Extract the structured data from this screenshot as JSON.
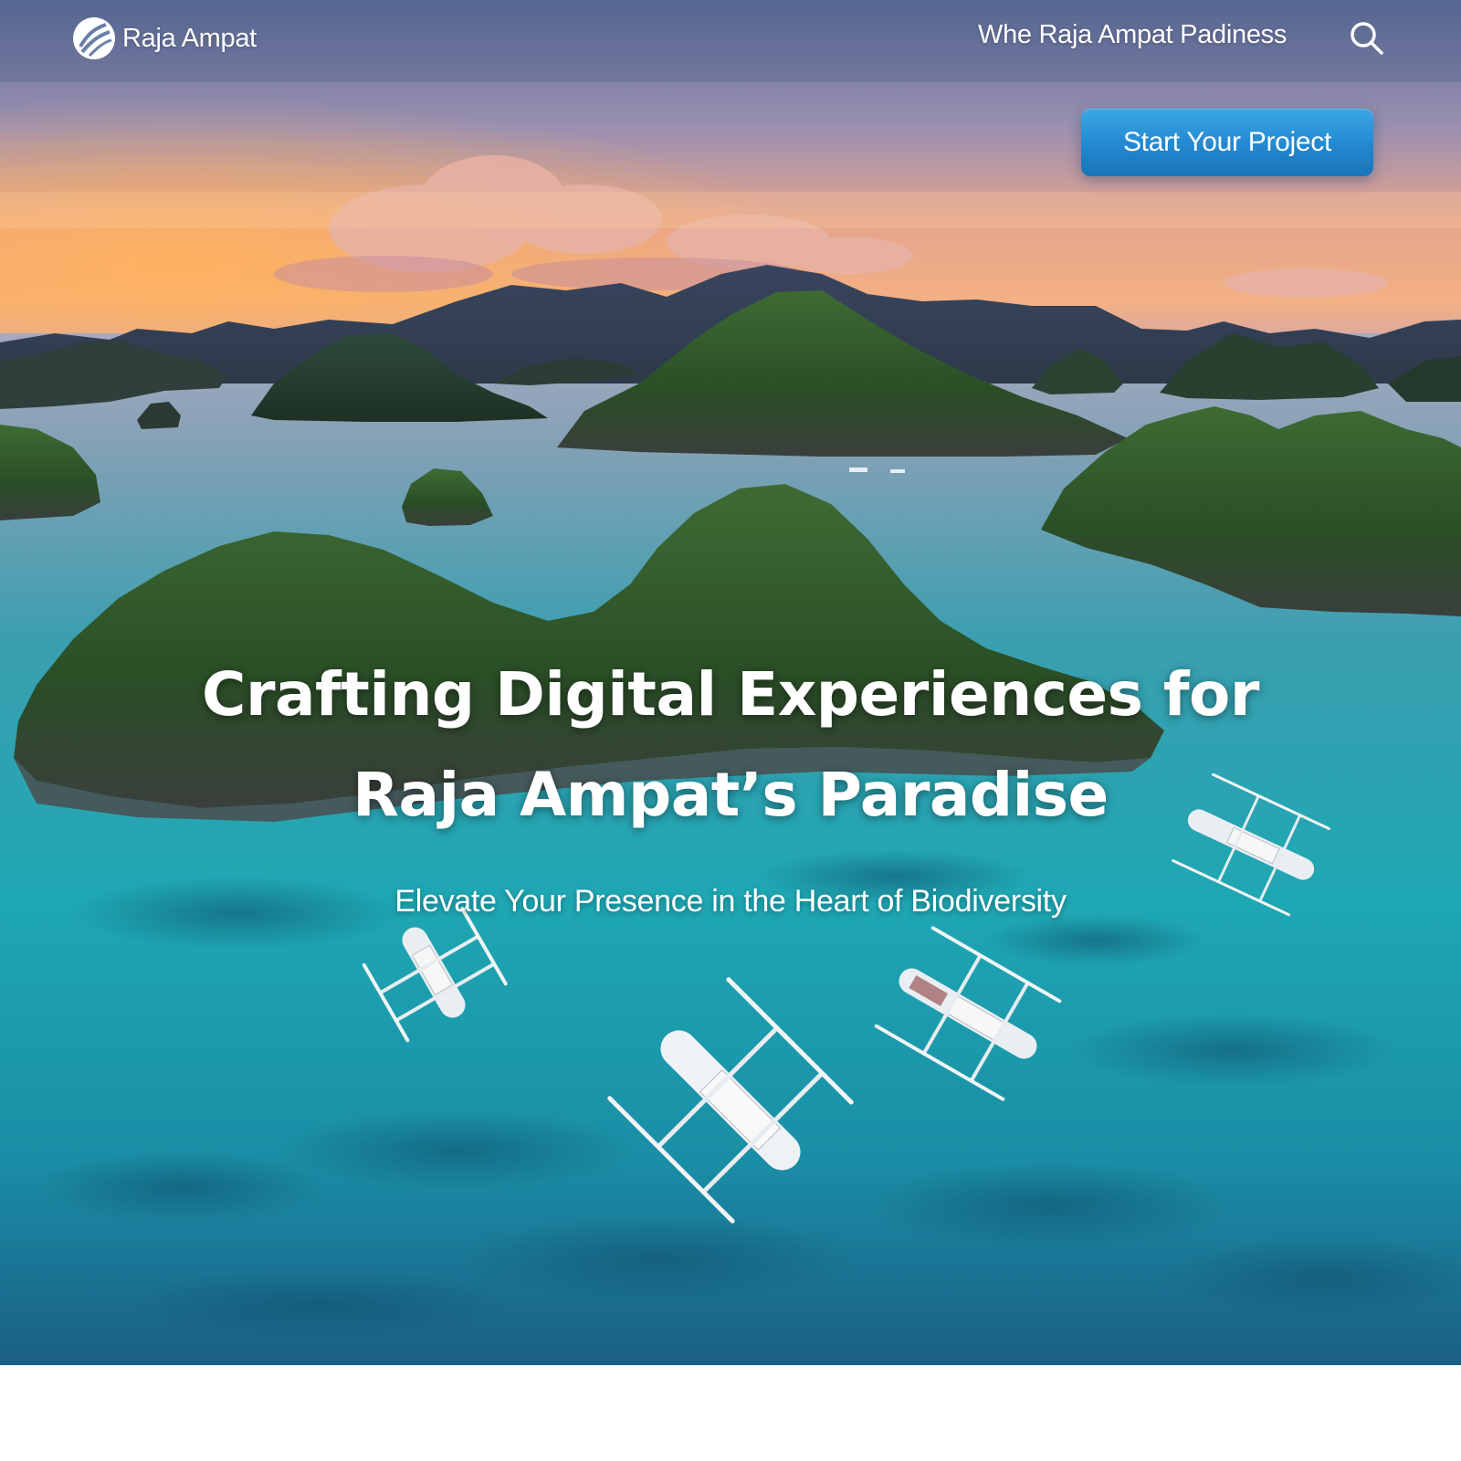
{
  "header": {
    "brand_name": "Raja Ampat",
    "nav_link": "Whe Raja Ampat Padiness",
    "search_icon": "search-icon",
    "cta_label": "Start Your Project"
  },
  "hero": {
    "title_line_1": "Crafting Digital Experiences for",
    "title_line_2": "Raja Ampat’s Paradise",
    "subtitle": "Elevate Your Presence in the Heart of Biodiversity",
    "background_image": "aerial-raja-ampat-islands-sunset-with-boats"
  },
  "colors": {
    "cta_background": "#2388cf",
    "text": "#ffffff",
    "water_turquoise": "#1aa6b0",
    "sky_sunset": "#f0a57a"
  }
}
